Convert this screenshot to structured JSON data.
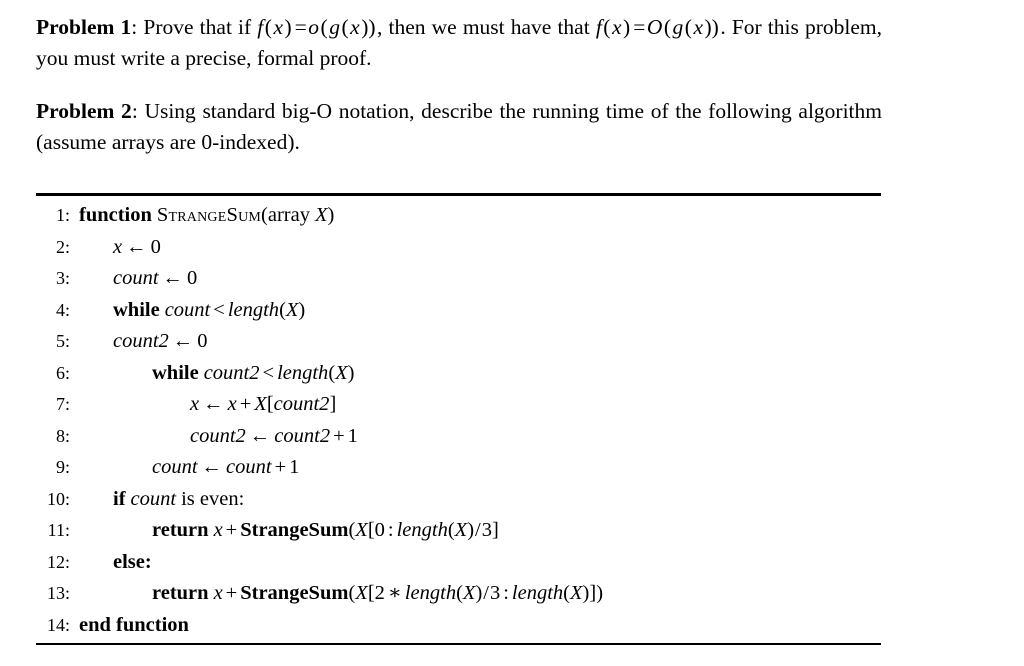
{
  "document": {
    "problems": [
      {
        "label": "Problem 1",
        "separator": ":",
        "text_before": "Prove that if ",
        "math_1": "f(x) = o(g(x))",
        "text_middle": ", then we must have that ",
        "math_2": "f(x) = O(g(x))",
        "text_after": ". For this problem, you must write a precise, formal proof.",
        "full_text": "Problem 1: Prove that if f(x) = o(g(x)), then we must have that f(x) = O(g(x)). For this problem, you must write a precise, formal proof."
      },
      {
        "label": "Problem 2",
        "separator": ":",
        "text_before": "Using standard big-O notation, describe the running time of the following algorithm (assume arrays are 0-indexed).",
        "full_text": "Problem 2: Using standard big-O notation, describe the running time of the following algorithm (assume arrays are 0-indexed)."
      }
    ],
    "algorithm": {
      "name": "StrangeSum",
      "lines": [
        {
          "no": "1",
          "indent": 0,
          "text": "function StrangeSum(array X)"
        },
        {
          "no": "2",
          "indent": 1,
          "text": "x ← 0"
        },
        {
          "no": "3",
          "indent": 1,
          "text": "count ← 0"
        },
        {
          "no": "4",
          "indent": 1,
          "text": "while count < length(X)"
        },
        {
          "no": "5",
          "indent": 1,
          "text": "count2 ← 0"
        },
        {
          "no": "6",
          "indent": 2,
          "text": "while count2 < length(X)"
        },
        {
          "no": "7",
          "indent": 3,
          "text": "x ← x + X[count2]"
        },
        {
          "no": "8",
          "indent": 3,
          "text": "count2 ← count2 + 1"
        },
        {
          "no": "9",
          "indent": 2,
          "text": "count ← count + 1"
        },
        {
          "no": "10",
          "indent": 1,
          "text": "if count is even:"
        },
        {
          "no": "11",
          "indent": 2,
          "text": "return x + StrangeSum(X[0 : length(X)/3]"
        },
        {
          "no": "12",
          "indent": 1,
          "text": "else:"
        },
        {
          "no": "13",
          "indent": 2,
          "text": "return x + StrangeSum(X[2 * length(X)/3 : length(X)])"
        },
        {
          "no": "14",
          "indent": 0,
          "text": "end function"
        }
      ]
    }
  }
}
